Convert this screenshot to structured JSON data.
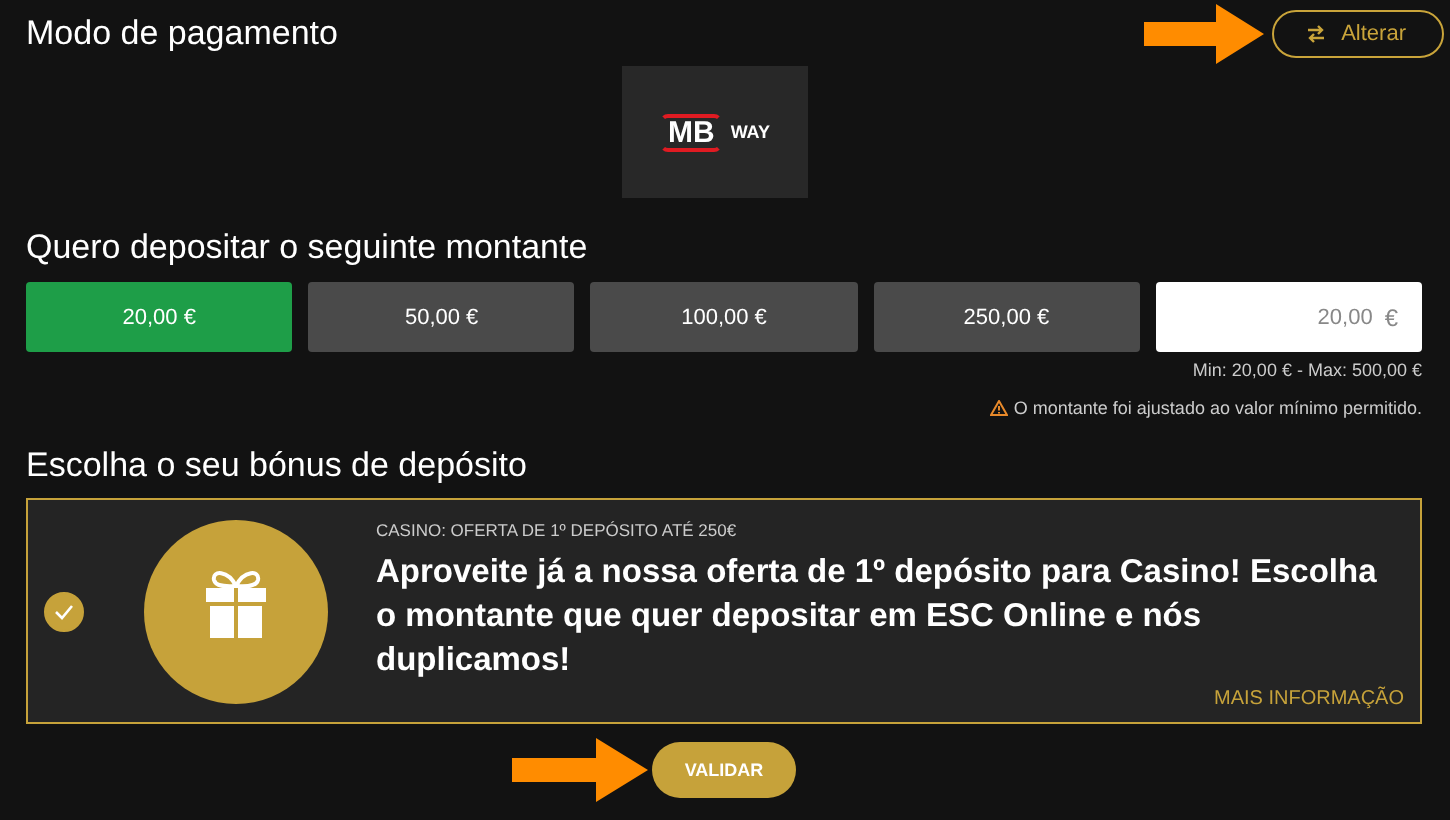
{
  "payment": {
    "title": "Modo de pagamento",
    "change_button": "Alterar",
    "method": {
      "logo_mark": "MB",
      "logo_word": "WAY"
    }
  },
  "amount": {
    "title": "Quero depositar o seguinte montante",
    "options": [
      {
        "label": "20,00 €",
        "selected": true
      },
      {
        "label": "50,00 €",
        "selected": false
      },
      {
        "label": "100,00 €",
        "selected": false
      },
      {
        "label": "250,00 €",
        "selected": false
      }
    ],
    "input": {
      "value": "20,00",
      "currency": "€"
    },
    "limits": "Min: 20,00 € - Max: 500,00 €",
    "warning": "O montante foi ajustado ao valor mínimo permitido."
  },
  "bonus": {
    "title": "Escolha o seu bónus de depósito",
    "offer": {
      "checked": true,
      "tag": "CASINO: OFERTA DE 1º DEPÓSITO ATÉ 250€",
      "text": "Aproveite já a nossa oferta de 1º depósito para Casino! Escolha o montante que quer depositar em ESC Online e nós duplicamos!",
      "more": "MAIS INFORMAÇÃO"
    }
  },
  "submit": "VALIDAR"
}
